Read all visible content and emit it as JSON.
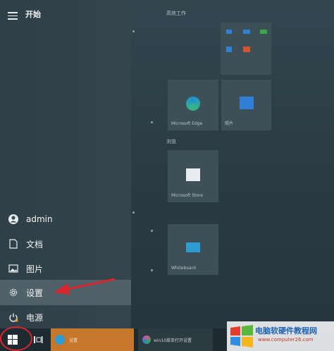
{
  "start": {
    "title": "开始"
  },
  "menu": {
    "user": "admin",
    "documents": "文档",
    "pictures": "图片",
    "settings": "设置",
    "power": "电源"
  },
  "tiles": {
    "section1": "高效工作",
    "section2": "浏览",
    "edge_label": "Microsoft Edge",
    "photos_label": "照片",
    "store_label": "Microsoft Store",
    "whiteboard_label": "Whiteboard"
  },
  "taskbar": {
    "app1_text": "设置",
    "app2_text": "win10菜单打开设置"
  },
  "watermark": {
    "title": "电脑软硬件教程网",
    "url": "www.computer26.com"
  },
  "colors": {
    "accent": "#c7772c",
    "annotation": "#d8262c"
  }
}
